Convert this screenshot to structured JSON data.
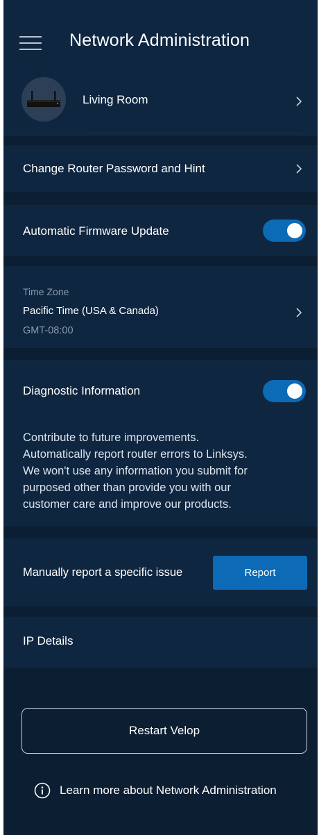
{
  "header": {
    "title": "Network Administration"
  },
  "device": {
    "name": "Living Room"
  },
  "rows": {
    "change_password": "Change Router Password and Hint",
    "firmware": "Automatic Firmware Update",
    "diagnostic": "Diagnostic Information",
    "ip_details": "IP Details"
  },
  "toggles": {
    "firmware_on": true,
    "diagnostic_on": true
  },
  "time_zone": {
    "label": "Time Zone",
    "value": "Pacific Time (USA & Canada)",
    "offset": "GMT-08:00"
  },
  "diagnostic_description": [
    "Contribute to future improvements.",
    "Automatically report router errors to Linksys.",
    "We won't use any information you submit for",
    "purposed other than provide you with our",
    "customer care and improve our products."
  ],
  "report": {
    "label": "Manually report a specific issue",
    "button": "Report"
  },
  "restart": {
    "button": "Restart Velop"
  },
  "learn_more": {
    "text": "Learn more about Network Administration"
  },
  "colors": {
    "background": "#0c1e31",
    "card": "#0f2640",
    "accent": "#0c6ab6",
    "muted_text": "#8b9aab"
  }
}
